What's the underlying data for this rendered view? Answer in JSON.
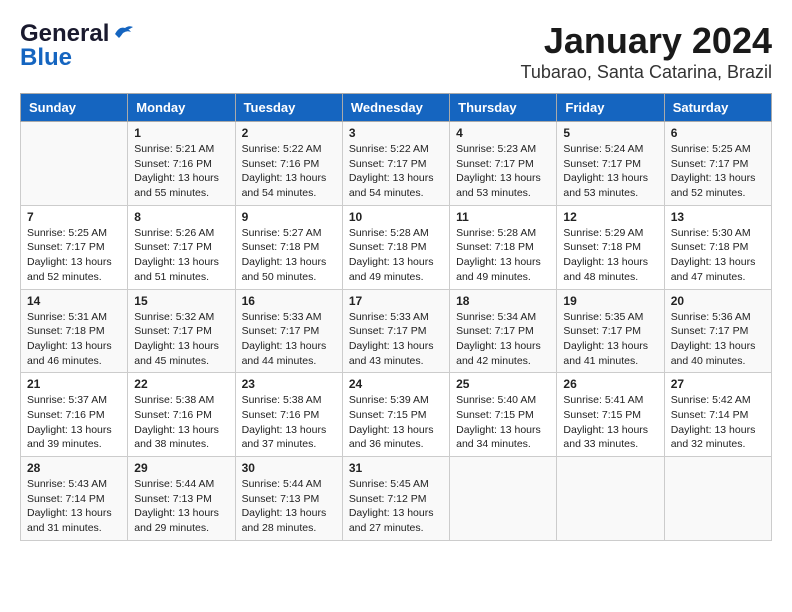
{
  "header": {
    "logo_line1": "General",
    "logo_line2": "Blue",
    "main_title": "January 2024",
    "subtitle": "Tubarao, Santa Catarina, Brazil"
  },
  "days_of_week": [
    "Sunday",
    "Monday",
    "Tuesday",
    "Wednesday",
    "Thursday",
    "Friday",
    "Saturday"
  ],
  "weeks": [
    [
      {
        "day": "",
        "sunrise": "",
        "sunset": "",
        "daylight": ""
      },
      {
        "day": "1",
        "sunrise": "Sunrise: 5:21 AM",
        "sunset": "Sunset: 7:16 PM",
        "daylight": "Daylight: 13 hours and 55 minutes."
      },
      {
        "day": "2",
        "sunrise": "Sunrise: 5:22 AM",
        "sunset": "Sunset: 7:16 PM",
        "daylight": "Daylight: 13 hours and 54 minutes."
      },
      {
        "day": "3",
        "sunrise": "Sunrise: 5:22 AM",
        "sunset": "Sunset: 7:17 PM",
        "daylight": "Daylight: 13 hours and 54 minutes."
      },
      {
        "day": "4",
        "sunrise": "Sunrise: 5:23 AM",
        "sunset": "Sunset: 7:17 PM",
        "daylight": "Daylight: 13 hours and 53 minutes."
      },
      {
        "day": "5",
        "sunrise": "Sunrise: 5:24 AM",
        "sunset": "Sunset: 7:17 PM",
        "daylight": "Daylight: 13 hours and 53 minutes."
      },
      {
        "day": "6",
        "sunrise": "Sunrise: 5:25 AM",
        "sunset": "Sunset: 7:17 PM",
        "daylight": "Daylight: 13 hours and 52 minutes."
      }
    ],
    [
      {
        "day": "7",
        "sunrise": "Sunrise: 5:25 AM",
        "sunset": "Sunset: 7:17 PM",
        "daylight": "Daylight: 13 hours and 52 minutes."
      },
      {
        "day": "8",
        "sunrise": "Sunrise: 5:26 AM",
        "sunset": "Sunset: 7:17 PM",
        "daylight": "Daylight: 13 hours and 51 minutes."
      },
      {
        "day": "9",
        "sunrise": "Sunrise: 5:27 AM",
        "sunset": "Sunset: 7:18 PM",
        "daylight": "Daylight: 13 hours and 50 minutes."
      },
      {
        "day": "10",
        "sunrise": "Sunrise: 5:28 AM",
        "sunset": "Sunset: 7:18 PM",
        "daylight": "Daylight: 13 hours and 49 minutes."
      },
      {
        "day": "11",
        "sunrise": "Sunrise: 5:28 AM",
        "sunset": "Sunset: 7:18 PM",
        "daylight": "Daylight: 13 hours and 49 minutes."
      },
      {
        "day": "12",
        "sunrise": "Sunrise: 5:29 AM",
        "sunset": "Sunset: 7:18 PM",
        "daylight": "Daylight: 13 hours and 48 minutes."
      },
      {
        "day": "13",
        "sunrise": "Sunrise: 5:30 AM",
        "sunset": "Sunset: 7:18 PM",
        "daylight": "Daylight: 13 hours and 47 minutes."
      }
    ],
    [
      {
        "day": "14",
        "sunrise": "Sunrise: 5:31 AM",
        "sunset": "Sunset: 7:18 PM",
        "daylight": "Daylight: 13 hours and 46 minutes."
      },
      {
        "day": "15",
        "sunrise": "Sunrise: 5:32 AM",
        "sunset": "Sunset: 7:17 PM",
        "daylight": "Daylight: 13 hours and 45 minutes."
      },
      {
        "day": "16",
        "sunrise": "Sunrise: 5:33 AM",
        "sunset": "Sunset: 7:17 PM",
        "daylight": "Daylight: 13 hours and 44 minutes."
      },
      {
        "day": "17",
        "sunrise": "Sunrise: 5:33 AM",
        "sunset": "Sunset: 7:17 PM",
        "daylight": "Daylight: 13 hours and 43 minutes."
      },
      {
        "day": "18",
        "sunrise": "Sunrise: 5:34 AM",
        "sunset": "Sunset: 7:17 PM",
        "daylight": "Daylight: 13 hours and 42 minutes."
      },
      {
        "day": "19",
        "sunrise": "Sunrise: 5:35 AM",
        "sunset": "Sunset: 7:17 PM",
        "daylight": "Daylight: 13 hours and 41 minutes."
      },
      {
        "day": "20",
        "sunrise": "Sunrise: 5:36 AM",
        "sunset": "Sunset: 7:17 PM",
        "daylight": "Daylight: 13 hours and 40 minutes."
      }
    ],
    [
      {
        "day": "21",
        "sunrise": "Sunrise: 5:37 AM",
        "sunset": "Sunset: 7:16 PM",
        "daylight": "Daylight: 13 hours and 39 minutes."
      },
      {
        "day": "22",
        "sunrise": "Sunrise: 5:38 AM",
        "sunset": "Sunset: 7:16 PM",
        "daylight": "Daylight: 13 hours and 38 minutes."
      },
      {
        "day": "23",
        "sunrise": "Sunrise: 5:38 AM",
        "sunset": "Sunset: 7:16 PM",
        "daylight": "Daylight: 13 hours and 37 minutes."
      },
      {
        "day": "24",
        "sunrise": "Sunrise: 5:39 AM",
        "sunset": "Sunset: 7:15 PM",
        "daylight": "Daylight: 13 hours and 36 minutes."
      },
      {
        "day": "25",
        "sunrise": "Sunrise: 5:40 AM",
        "sunset": "Sunset: 7:15 PM",
        "daylight": "Daylight: 13 hours and 34 minutes."
      },
      {
        "day": "26",
        "sunrise": "Sunrise: 5:41 AM",
        "sunset": "Sunset: 7:15 PM",
        "daylight": "Daylight: 13 hours and 33 minutes."
      },
      {
        "day": "27",
        "sunrise": "Sunrise: 5:42 AM",
        "sunset": "Sunset: 7:14 PM",
        "daylight": "Daylight: 13 hours and 32 minutes."
      }
    ],
    [
      {
        "day": "28",
        "sunrise": "Sunrise: 5:43 AM",
        "sunset": "Sunset: 7:14 PM",
        "daylight": "Daylight: 13 hours and 31 minutes."
      },
      {
        "day": "29",
        "sunrise": "Sunrise: 5:44 AM",
        "sunset": "Sunset: 7:13 PM",
        "daylight": "Daylight: 13 hours and 29 minutes."
      },
      {
        "day": "30",
        "sunrise": "Sunrise: 5:44 AM",
        "sunset": "Sunset: 7:13 PM",
        "daylight": "Daylight: 13 hours and 28 minutes."
      },
      {
        "day": "31",
        "sunrise": "Sunrise: 5:45 AM",
        "sunset": "Sunset: 7:12 PM",
        "daylight": "Daylight: 13 hours and 27 minutes."
      },
      {
        "day": "",
        "sunrise": "",
        "sunset": "",
        "daylight": ""
      },
      {
        "day": "",
        "sunrise": "",
        "sunset": "",
        "daylight": ""
      },
      {
        "day": "",
        "sunrise": "",
        "sunset": "",
        "daylight": ""
      }
    ]
  ]
}
